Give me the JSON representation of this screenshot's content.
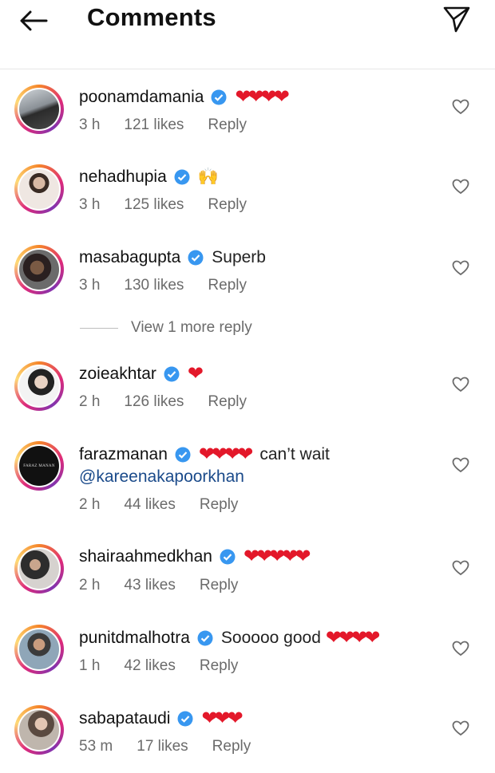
{
  "header": {
    "title": "Comments",
    "back_icon": "arrow-left-icon",
    "share_icon": "paper-plane-icon"
  },
  "more_replies": "View 1 more reply",
  "comments": [
    {
      "user": "poonamdamania",
      "hearts": "❤❤❤❤",
      "text": "",
      "time": "3 h",
      "likes": "121 likes",
      "reply": "Reply"
    },
    {
      "user": "nehadhupia",
      "hearts": "",
      "text": "🙌",
      "time": "3 h",
      "likes": "125 likes",
      "reply": "Reply"
    },
    {
      "user": "masabagupta",
      "hearts": "",
      "text": "Superb",
      "time": "3 h",
      "likes": "130 likes",
      "reply": "Reply"
    },
    {
      "user": "zoieakhtar",
      "hearts": "❤",
      "text": "",
      "time": "2 h",
      "likes": "126 likes",
      "reply": "Reply"
    },
    {
      "user": "farazmanan",
      "hearts": "❤❤❤❤",
      "text": "can’t wait",
      "mention": "@kareenakapoorkhan",
      "avatar_text": "FARAZ MANAN",
      "time": "2 h",
      "likes": "44 likes",
      "reply": "Reply"
    },
    {
      "user": "shairaahmedkhan",
      "hearts": "❤❤❤❤❤",
      "text": "",
      "time": "2 h",
      "likes": "43 likes",
      "reply": "Reply"
    },
    {
      "user": "punitdmalhotra",
      "hearts": "❤❤❤❤",
      "text": "Sooooo good",
      "time": "1 h",
      "likes": "42 likes",
      "reply": "Reply"
    },
    {
      "user": "sabapataudi",
      "hearts": "❤❤❤",
      "text": "",
      "time": "53 m",
      "likes": "17 likes",
      "reply": "Reply"
    }
  ],
  "colors": {
    "heart": "#e3182a",
    "verified": "#3897f0",
    "meta": "#6b6b6b",
    "mention": "#1a4a8a"
  }
}
